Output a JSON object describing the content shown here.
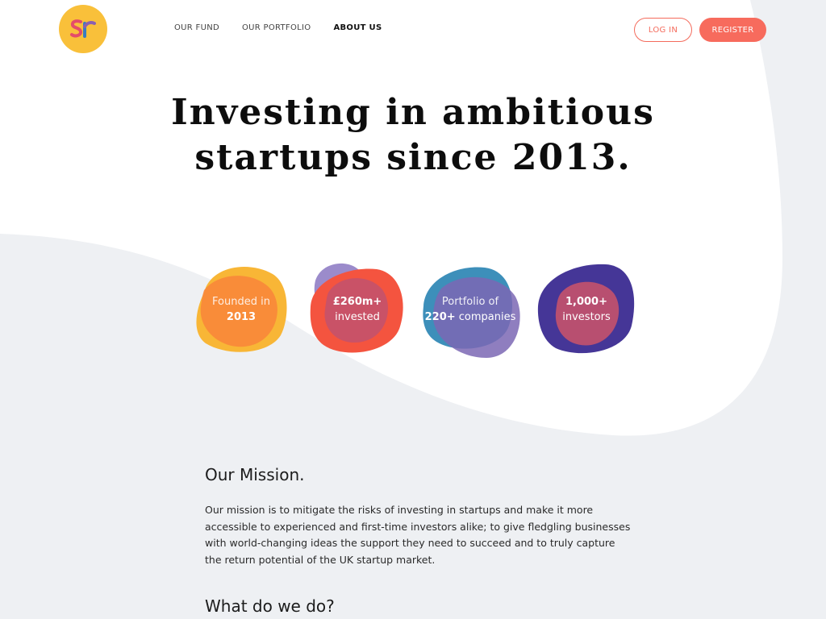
{
  "brand": {
    "logo_text": "sr",
    "logo_color": "#f9c03a"
  },
  "nav": {
    "items": [
      {
        "label": "OUR FUND"
      },
      {
        "label": "OUR PORTFOLIO"
      },
      {
        "label": "ABOUT US"
      }
    ],
    "active": "ABOUT US"
  },
  "auth": {
    "login_label": "LOG IN",
    "register_label": "REGISTER"
  },
  "hero": {
    "title": "Investing in ambitious startups since 2013."
  },
  "stats": [
    {
      "line1": "Founded in",
      "line2": "2013"
    },
    {
      "line1": "£260m+",
      "line2": "invested"
    },
    {
      "line1_a": "Portfolio of",
      "line2_bold": "220+",
      "line2_rest": " companies"
    },
    {
      "line1": "1,000+",
      "line2": "investors"
    }
  ],
  "mission": {
    "heading": "Our Mission.",
    "body": "Our mission is to mitigate the risks of investing in startups and make it more accessible to experienced and first-time investors alike; to give fledgling businesses with world-changing ideas the support they need to succeed and to truly capture the return potential of the UK startup market."
  },
  "what_we_do": {
    "heading": "What do we do?"
  },
  "colors": {
    "accent": "#f76b5d",
    "background_wave": "#eef0f3",
    "blob_yellow": "#f8b636",
    "blob_orange": "#f9853a",
    "blob_red": "#f4543f",
    "blob_purple": "#7b67b4",
    "blob_teal": "#3d8fba",
    "blob_indigo": "#453697",
    "blob_pink": "#c4526c"
  }
}
